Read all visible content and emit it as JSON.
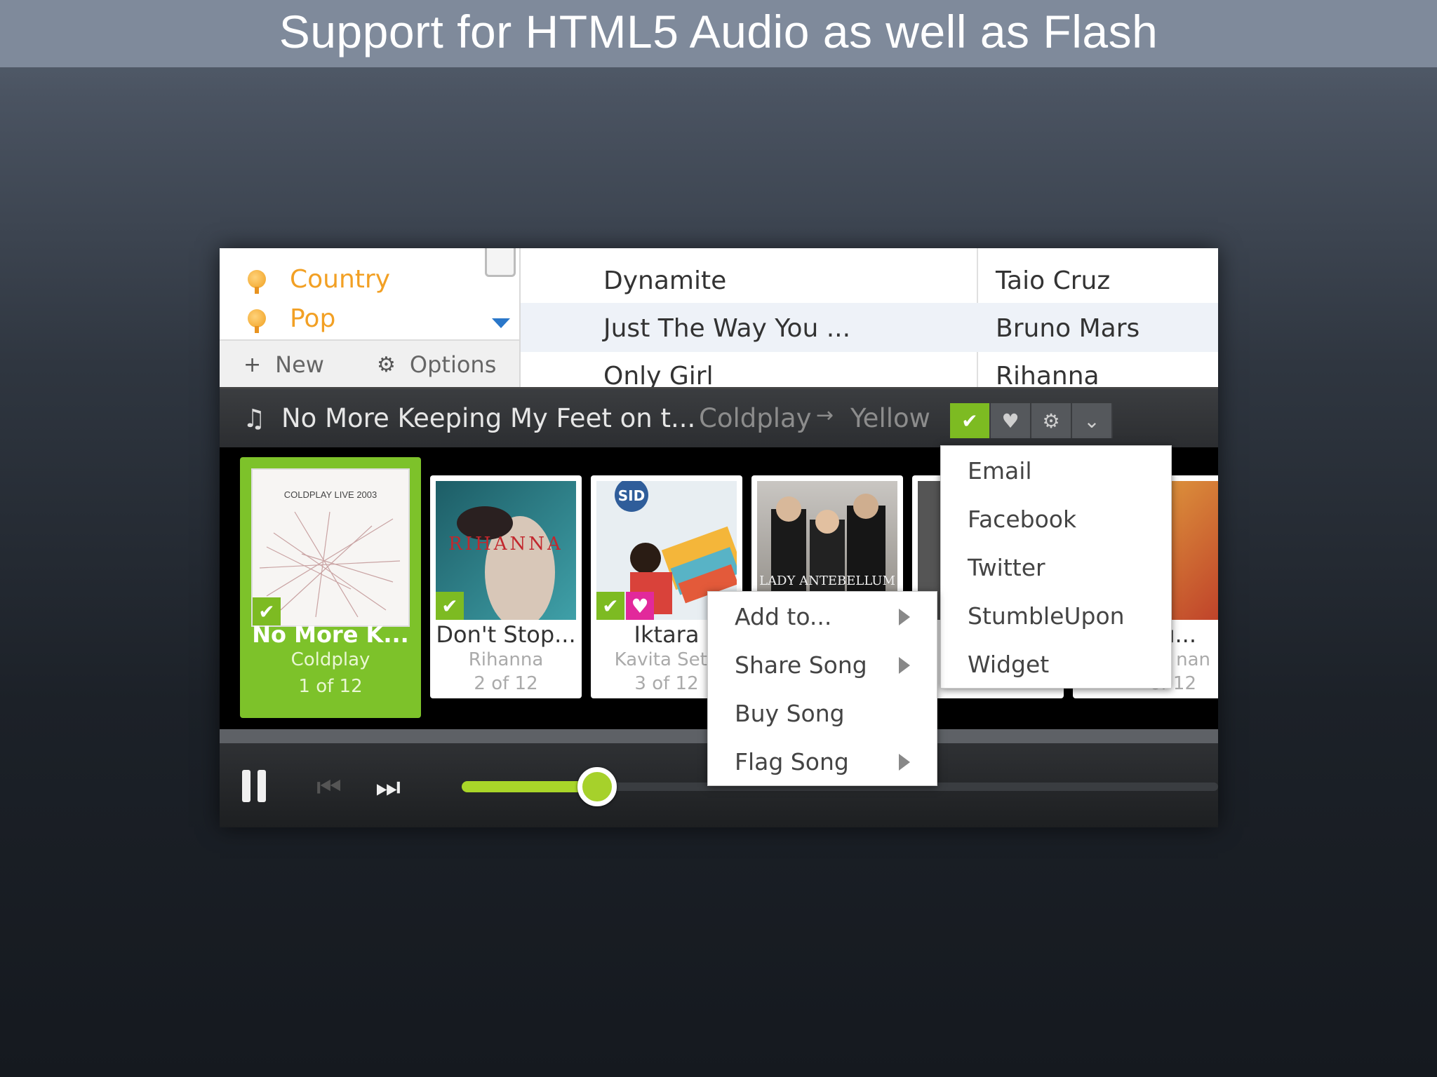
{
  "slide": {
    "title": "Support for HTML5 Audio as well as Flash"
  },
  "sidebar": {
    "items": [
      {
        "label": "Country"
      },
      {
        "label": "Pop"
      }
    ],
    "new_label": "New",
    "options_label": "Options"
  },
  "tracks": [
    {
      "title": "Dynamite",
      "artist": "Taio Cruz"
    },
    {
      "title": "Just The Way You ...",
      "artist": "Bruno Mars"
    },
    {
      "title": "Only Girl",
      "artist": "Rihanna"
    }
  ],
  "now_playing": {
    "song": "No More Keeping My Feet on t...",
    "artist": "Coldplay",
    "separator": "→",
    "album": "Yellow"
  },
  "carousel": [
    {
      "title": "No More K...",
      "artist": "Coldplay",
      "count": "1 of 12",
      "art_text": "COLDPLAY LIVE 2003"
    },
    {
      "title": "Don't Stop...",
      "artist": "Rihanna",
      "count": "2 of 12",
      "art_text": "RIHANNA"
    },
    {
      "title": "Iktara",
      "artist": "Kavita Seth",
      "count": "3 of 12",
      "art_text": "SID"
    },
    {
      "title": "",
      "artist": "",
      "count": "",
      "art_text": "LADY ANTEBELLUM"
    },
    {
      "title": "u...",
      "artist": "nan",
      "count": "of 12"
    }
  ],
  "share_menu": [
    "Email",
    "Facebook",
    "Twitter",
    "StumbleUpon",
    "Widget"
  ],
  "song_menu": [
    {
      "label": "Add to...",
      "submenu": true
    },
    {
      "label": "Share Song",
      "submenu": true
    },
    {
      "label": "Buy Song",
      "submenu": false
    },
    {
      "label": "Flag Song",
      "submenu": true
    }
  ],
  "playback": {
    "progress": 0.34
  },
  "colors": {
    "accent_green": "#7dc22a",
    "heart_pink": "#e2299b",
    "sidebar_orange": "#f2a024"
  }
}
